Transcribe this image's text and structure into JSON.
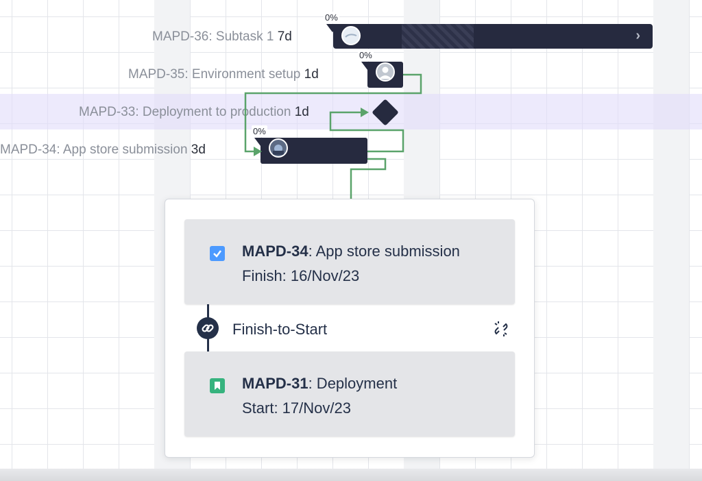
{
  "tasks": [
    {
      "key": "MAPD-36",
      "name": "Subtask 1",
      "label": "MAPD-36: Subtask 1",
      "duration": "7d",
      "progress": "0%"
    },
    {
      "key": "MAPD-35",
      "name": "Environment setup",
      "label": "MAPD-35: Environment setup",
      "duration": "1d",
      "progress": "0%"
    },
    {
      "key": "MAPD-33",
      "name": "Deployment to production",
      "label": "MAPD-33: Deployment to production",
      "duration": "1d"
    },
    {
      "key": "MAPD-34",
      "name": "App store submission",
      "label": "MAPD-34: App store submission",
      "duration": "3d",
      "progress": "0%"
    }
  ],
  "dependency_popup": {
    "from": {
      "key": "MAPD-34",
      "name": ": App store submission",
      "date_line": "Finish: 16/Nov/23",
      "type_icon": "checkbox-task-icon"
    },
    "link_type": "Finish-to-Start",
    "link_icon": "link-icon",
    "unlink_icon": "unlink-icon",
    "to": {
      "key": "MAPD-31",
      "name": ": Deployment",
      "date_line": "Start: 17/Nov/23",
      "type_icon": "bookmark-story-icon"
    }
  },
  "colors": {
    "bar": "#262a3f",
    "dependency_line": "#5aa36a",
    "highlight_row": "#e1dcfa",
    "task_icon": "#4c9aff",
    "story_icon": "#36b37e"
  }
}
